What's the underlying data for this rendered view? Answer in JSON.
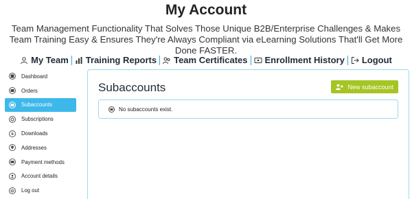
{
  "header": {
    "title": "My Account",
    "subtitle": "Team Management Functionality That Solves Those Unique B2B/Enterprise Challenges & Makes Team Training Easy & Ensures They're Always Compliant via eLearning Solutions That'll Get More Done FASTER."
  },
  "team_nav": {
    "items": [
      {
        "label": "My Team",
        "icon": "team-icon"
      },
      {
        "label": "Training Reports",
        "icon": "reports-icon"
      },
      {
        "label": "Team Certificates",
        "icon": "certificates-icon"
      },
      {
        "label": "Enrollment History",
        "icon": "history-icon"
      },
      {
        "label": "Logout",
        "icon": "logout-icon"
      }
    ]
  },
  "sidebar": {
    "items": [
      {
        "label": "Dashboard",
        "icon": "dashboard-icon",
        "active": false
      },
      {
        "label": "Orders",
        "icon": "orders-icon",
        "active": false
      },
      {
        "label": "Subaccounts",
        "icon": "subaccounts-icon",
        "active": true
      },
      {
        "label": "Subscriptions",
        "icon": "subscriptions-icon",
        "active": false
      },
      {
        "label": "Downloads",
        "icon": "downloads-icon",
        "active": false
      },
      {
        "label": "Addresses",
        "icon": "addresses-icon",
        "active": false
      },
      {
        "label": "Payment methods",
        "icon": "payment-icon",
        "active": false
      },
      {
        "label": "Account details",
        "icon": "account-icon",
        "active": false
      },
      {
        "label": "Log out",
        "icon": "logout-icon",
        "active": false
      }
    ]
  },
  "main": {
    "title": "Subaccounts",
    "new_button_label": "New subaccount",
    "empty_message": "No subaccounts exist."
  },
  "colors": {
    "accent_blue": "#3db8ea",
    "button_green": "#a5c523",
    "border_blue": "#9fd6f0"
  }
}
